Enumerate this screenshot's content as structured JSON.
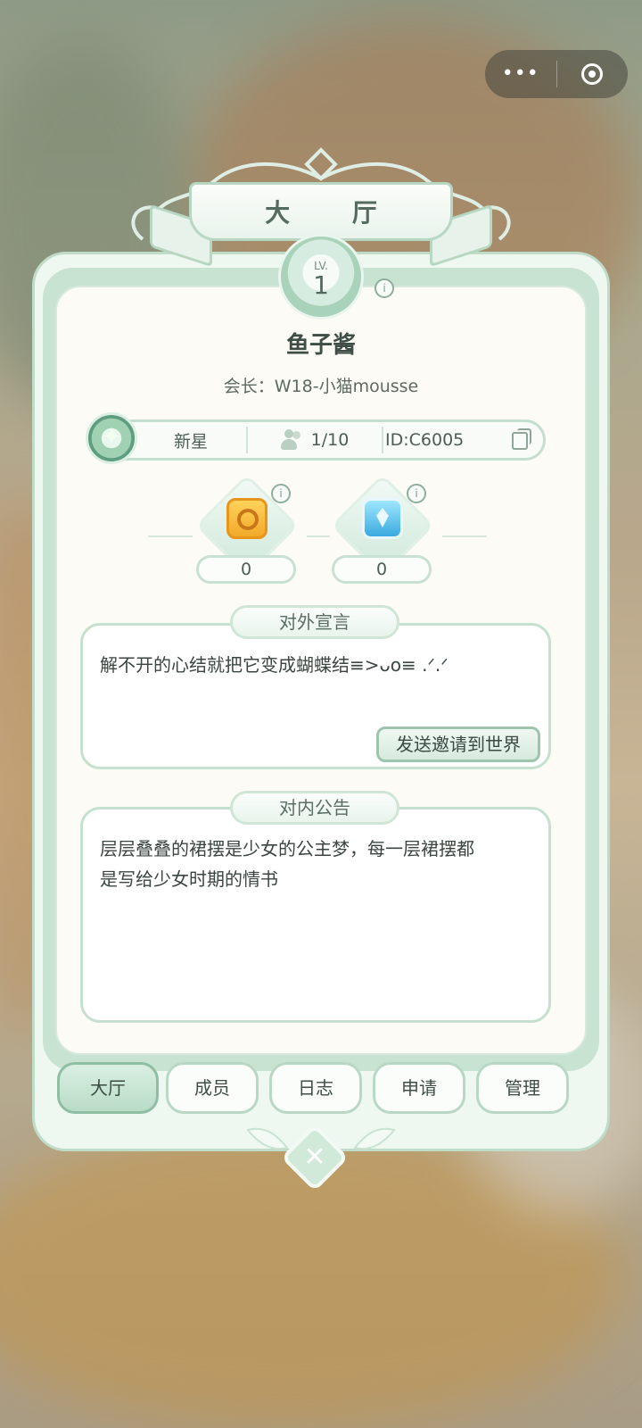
{
  "window": {
    "capsule_more": "•••"
  },
  "header": {
    "title": "大 厅"
  },
  "level": {
    "prefix": "LV.",
    "value": "1"
  },
  "guild": {
    "name": "鱼子酱",
    "leader": "会长：W18-小猫mousse",
    "rank": "新星",
    "members": "1/10",
    "id": "ID:C6005"
  },
  "resources": [
    {
      "icon": "gold-coin-icon",
      "count": "0"
    },
    {
      "icon": "blue-crystal-icon",
      "count": "0"
    }
  ],
  "external": {
    "title": "对外宣言",
    "text": "解不开的心结就把它变成蝴蝶结≡>ᴗo≡ .ᐟ.ᐟ",
    "send_label": "发送邀请到世界"
  },
  "internal": {
    "title": "对内公告",
    "text_line1": "层层叠叠的裙摆是少女的公主梦，每一层裙摆都",
    "text_line2": "是写给少女时期的情书"
  },
  "tabs": [
    "大厅",
    "成员",
    "日志",
    "申请",
    "管理"
  ],
  "colors": {
    "accent": "#c6e0cf",
    "panel": "#fdfbf5",
    "text": "#3f4d47"
  }
}
